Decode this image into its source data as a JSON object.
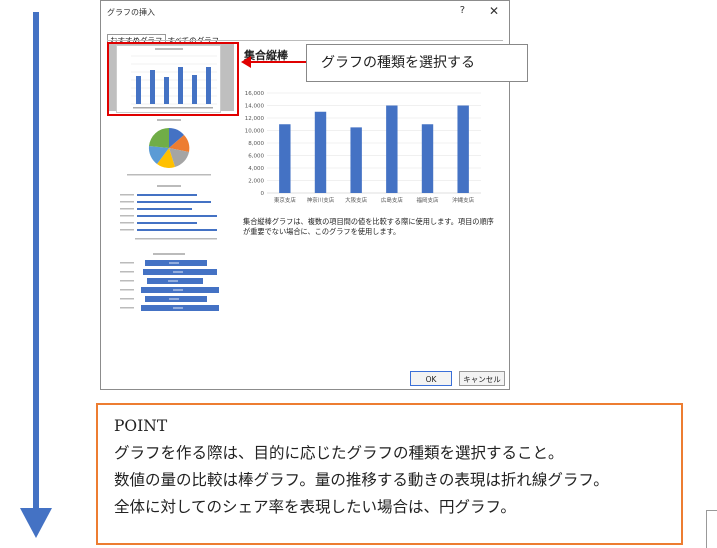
{
  "dialog": {
    "title": "グラフの挿入",
    "help_label": "?",
    "close_label": "✕",
    "tabs": [
      {
        "label": "おすすめグラフ",
        "active": true
      },
      {
        "label": "すべてのグラフ",
        "active": false
      }
    ],
    "selected_chart_title": "集合縦棒",
    "description": "集合縦棒グラフは、複数の項目間の値を比較する際に使用します。項目の順序が重要でない場合に、このグラフを使用します。",
    "ok_label": "OK",
    "cancel_label": "キャンセル"
  },
  "callout": {
    "text": "グラフの種類を選択する",
    "border_color": "#888888",
    "arrow_color": "#e00000"
  },
  "point": {
    "heading": "POINT",
    "lines": [
      "グラフを作る際は、目的に応じたグラフの種類を選択すること。",
      "数値の量の比較は棒グラフ。量の推移する動きの表現は折れ線グラフ。",
      "全体に対してのシェア率を表現したい場合は、円グラフ。"
    ],
    "border_color": "#ed7d31"
  },
  "arrow_color": "#4472c4",
  "chart_data": {
    "type": "bar",
    "categories": [
      "東京支店",
      "神奈川支店",
      "大阪支店",
      "広島支店",
      "福岡支店",
      "沖縄支店"
    ],
    "values": [
      11000,
      13000,
      10500,
      14000,
      11000,
      14000
    ],
    "title": "",
    "xlabel": "",
    "ylabel": "",
    "ylim": [
      0,
      16000
    ],
    "yticks": [
      "0",
      "2,000",
      "4,000",
      "6,000",
      "8,000",
      "10,000",
      "12,000",
      "14,000",
      "16,000"
    ],
    "grid": true,
    "bar_color": "#4472c4"
  }
}
